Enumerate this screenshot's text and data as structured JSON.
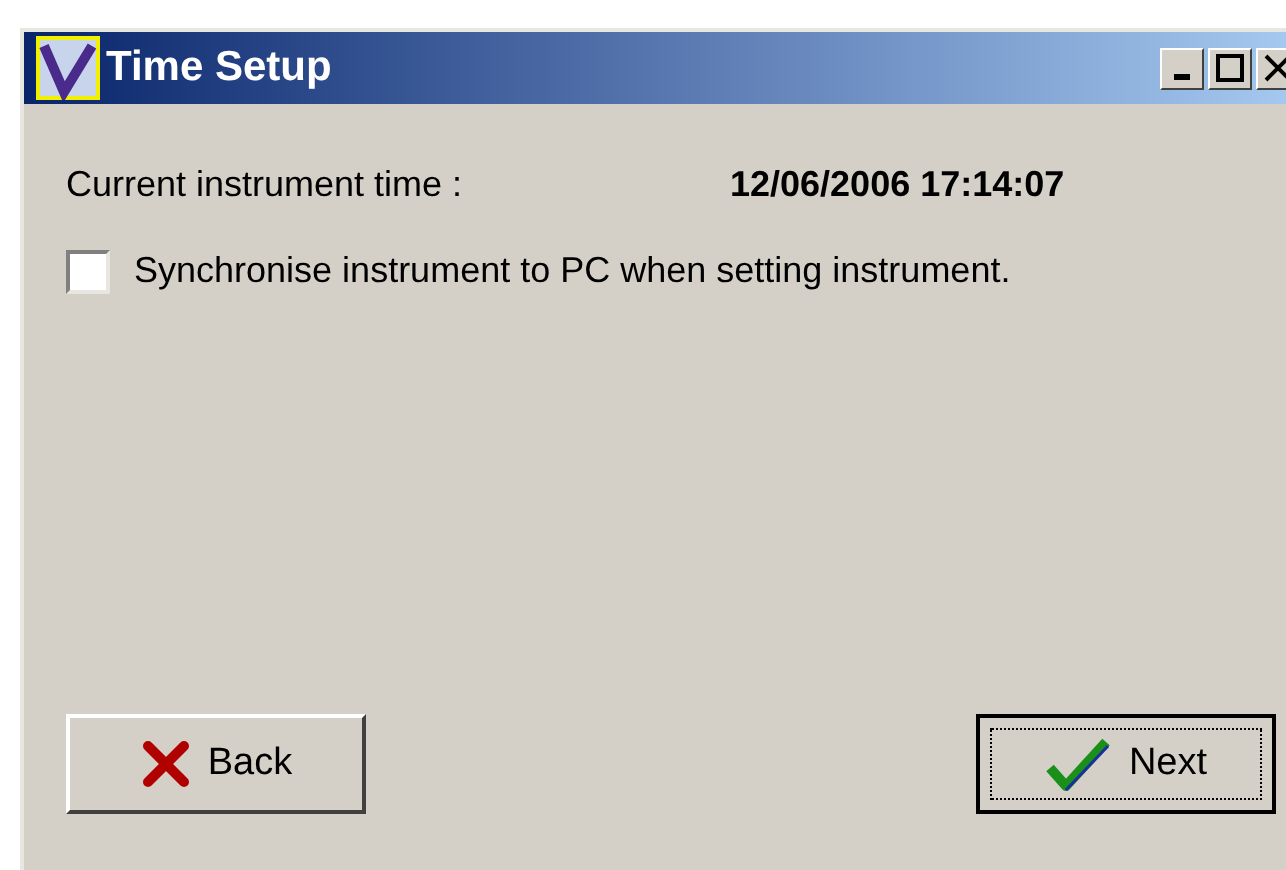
{
  "window": {
    "title": "Time Setup"
  },
  "instrument_time": {
    "label": "Current instrument time :",
    "value": "12/06/2006 17:14:07"
  },
  "sync_option": {
    "label": "Synchronise instrument to PC when setting instrument.",
    "checked": false
  },
  "buttons": [
    {
      "kind": "back",
      "label": "Back",
      "default": false
    },
    {
      "kind": "next",
      "label": "Next",
      "default": true
    }
  ]
}
